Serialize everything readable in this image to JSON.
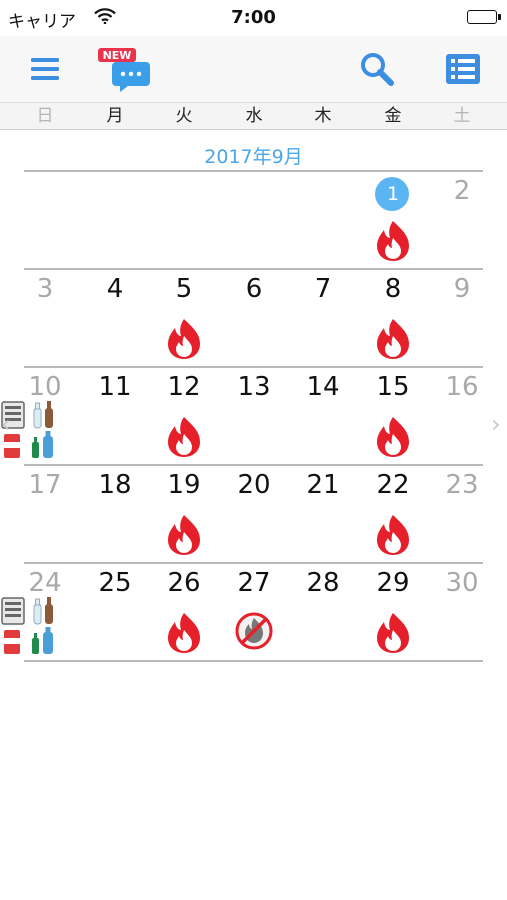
{
  "status": {
    "carrier": "キャリア",
    "time": "7:00"
  },
  "toolbar": {
    "new_badge": "NEW"
  },
  "weekdays": [
    "日",
    "月",
    "火",
    "水",
    "木",
    "金",
    "土"
  ],
  "month_title": "2017年9月",
  "weeks": [
    {
      "days": [
        {
          "num": "",
          "icon": ""
        },
        {
          "num": "",
          "icon": ""
        },
        {
          "num": "",
          "icon": ""
        },
        {
          "num": "",
          "icon": ""
        },
        {
          "num": "",
          "icon": ""
        },
        {
          "num": "1",
          "icon": "burnable-icon",
          "today": true
        },
        {
          "num": "2",
          "icon": ""
        }
      ]
    },
    {
      "days": [
        {
          "num": "3",
          "icon": ""
        },
        {
          "num": "4",
          "icon": ""
        },
        {
          "num": "5",
          "icon": "burnable-icon"
        },
        {
          "num": "6",
          "icon": ""
        },
        {
          "num": "7",
          "icon": ""
        },
        {
          "num": "8",
          "icon": "burnable-icon"
        },
        {
          "num": "9",
          "icon": ""
        }
      ]
    },
    {
      "days": [
        {
          "num": "10",
          "icon": "recyclables-icon"
        },
        {
          "num": "11",
          "icon": ""
        },
        {
          "num": "12",
          "icon": "burnable-icon"
        },
        {
          "num": "13",
          "icon": ""
        },
        {
          "num": "14",
          "icon": ""
        },
        {
          "num": "15",
          "icon": "burnable-icon"
        },
        {
          "num": "16",
          "icon": ""
        }
      ]
    },
    {
      "days": [
        {
          "num": "17",
          "icon": ""
        },
        {
          "num": "18",
          "icon": ""
        },
        {
          "num": "19",
          "icon": "burnable-icon"
        },
        {
          "num": "20",
          "icon": ""
        },
        {
          "num": "21",
          "icon": ""
        },
        {
          "num": "22",
          "icon": "burnable-icon"
        },
        {
          "num": "23",
          "icon": ""
        }
      ]
    },
    {
      "days": [
        {
          "num": "24",
          "icon": "recyclables-icon"
        },
        {
          "num": "25",
          "icon": ""
        },
        {
          "num": "26",
          "icon": "burnable-icon"
        },
        {
          "num": "27",
          "icon": "non-burnable-icon"
        },
        {
          "num": "28",
          "icon": ""
        },
        {
          "num": "29",
          "icon": "burnable-icon"
        },
        {
          "num": "30",
          "icon": ""
        }
      ]
    }
  ],
  "nav": {
    "prev": "‹",
    "next": "›"
  },
  "colors": {
    "accent": "#4aa6e8",
    "today": "#5ab5f2",
    "fire": "#e5202a",
    "muted": "#a9a9a9"
  }
}
